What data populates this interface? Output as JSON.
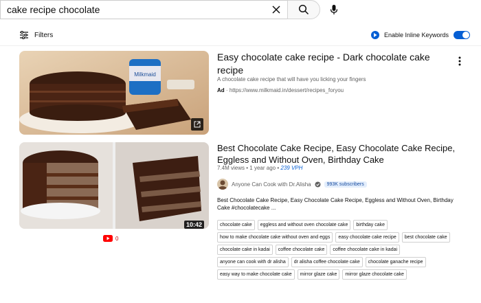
{
  "search": {
    "query": "cake recipe chocolate",
    "clear_icon": "close-icon",
    "search_icon": "search-icon",
    "mic_icon": "mic-icon"
  },
  "filters": {
    "label": "Filters",
    "inline_keywords_label": "Enable Inline Keywords",
    "toggle_on": true
  },
  "ad": {
    "title": "Easy chocolate cake recipe - Dark chocolate cake recipe",
    "description": "A chocolate cake recipe that will have you licking your fingers",
    "badge": "Ad",
    "separator": "·",
    "url": "https://www.milkmaid.in/dessert/recipes_foryou",
    "open_icon": "open-in-new-icon"
  },
  "video": {
    "title": "Best Chocolate Cake Recipe, Easy Chocolate Cake Recipe, Eggless and Without Oven, Birthday Cake",
    "views": "7.4M views",
    "dot": "•",
    "age": "1 year ago",
    "vph": "239 VPH",
    "channel": "Anyone Can Cook with Dr.Alisha",
    "subscribers": "993K subscribers",
    "description": "Best Chocolate Cake Recipe, Easy Chocolate Cake Recipe, Eggless and Without Oven, Birthday Cake #chocolatecake ...",
    "duration": "10:42",
    "live_count": "0",
    "tags": [
      "chocolate cake",
      "eggless and without oven chocolate cake",
      "birthday cake",
      "how to make chocolate cake without oven and eggs",
      "easy chocolate cake recipe",
      "best chocolate cake",
      "chocolate cake in kadai",
      "coffee chocolate cake",
      "coffee chocolate cake in kadai",
      "anyone can cook with dr alisha",
      "dr alisha coffee chocolate cake",
      "chocolate ganache recipe",
      "easy way to make chocolate cake",
      "mirror glaze cake",
      "mirror glaze chocolate cake"
    ]
  },
  "colors": {
    "accent": "#065fd4",
    "youtube_red": "#ff0000",
    "text_secondary": "#606060"
  }
}
